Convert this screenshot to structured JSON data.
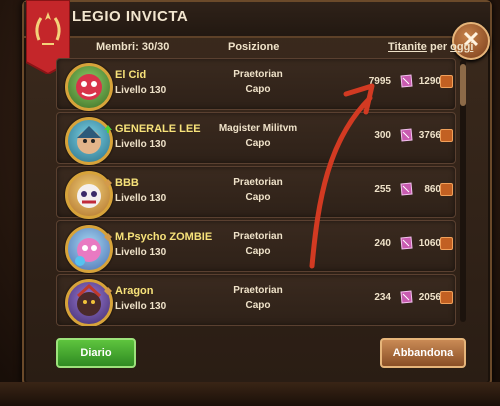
{
  "header": {
    "title": "LEGIO INVICTA",
    "members": "Membri: 30/30",
    "position_label": "Posizione",
    "titanite_label": "Titanite",
    "per_label": "per",
    "period_label": "oggi"
  },
  "members": [
    {
      "name": "El Cid",
      "level": "Livello 130",
      "role": "Praetorian",
      "rank": "Capo",
      "titanite": "7995",
      "score": "1290",
      "name_color": "#f7e27a",
      "rank_icon": "diamond-icon"
    },
    {
      "name": "GENERALE LEE",
      "level": "Livello 130",
      "role": "Magister Militvm",
      "rank": "Capo",
      "titanite": "300",
      "score": "3766",
      "name_color": "#f7e27a",
      "rank_icon": "green-arrow-icon"
    },
    {
      "name": "BBB",
      "level": "Livello 130",
      "role": "Praetorian",
      "rank": "Capo",
      "titanite": "255",
      "score": "860",
      "name_color": "#f7e27a",
      "rank_icon": "diamond-icon"
    },
    {
      "name": "M.Psycho ZOMBIE",
      "level": "Livello 130",
      "role": "Praetorian",
      "rank": "Capo",
      "titanite": "240",
      "score": "1060",
      "name_color": "#f7e27a",
      "rank_icon": "diamond-icon"
    },
    {
      "name": "Aragon",
      "level": "Livello 130",
      "role": "Praetorian",
      "rank": "Capo",
      "titanite": "234",
      "score": "2056",
      "name_color": "#f7e27a",
      "rank_icon": "diamond-icon"
    }
  ],
  "buttons": {
    "diary": "Diario",
    "leave": "Abbandona"
  },
  "colors": {
    "accent_green": "#3fa82c",
    "accent_brown": "#a8693a",
    "banner_red": "#c4262a",
    "arrow_red": "#d23a22"
  }
}
